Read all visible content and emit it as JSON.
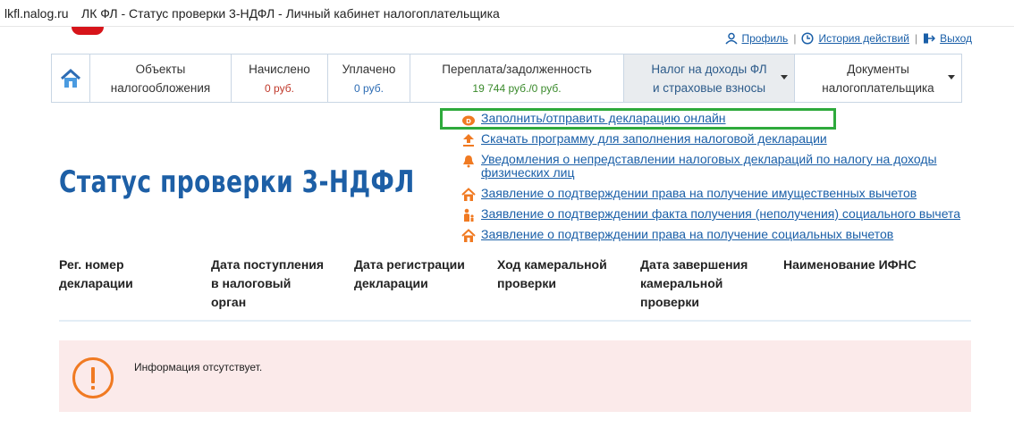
{
  "browser": {
    "domain": "lkfl.nalog.ru",
    "title": "ЛК ФЛ - Статус проверки 3-НДФЛ - Личный кабинет налогоплательщика"
  },
  "header": {
    "profile": "Профиль",
    "history": "История действий",
    "logout": "Выход"
  },
  "nav": {
    "objects": {
      "line1": "Объекты",
      "line2": "налогообложения"
    },
    "charged": {
      "label": "Начислено",
      "value": "0 руб."
    },
    "paid": {
      "label": "Уплачено",
      "value": "0 руб."
    },
    "balance": {
      "label": "Переплата/задолженность",
      "value": "19 744 руб./0 руб."
    },
    "tax": {
      "line1": "Налог на доходы ФЛ",
      "line2": "и страховые взносы"
    },
    "docs": {
      "line1": "Документы",
      "line2": "налогоплательщика"
    }
  },
  "menu": {
    "items": [
      {
        "label": "Заполнить/отправить декларацию онлайн",
        "icon": "declaration-icon"
      },
      {
        "label": "Скачать программу для заполнения налоговой декларации",
        "icon": "download-icon"
      },
      {
        "label_l1": "Уведомления о непредставлении налоговых деклараций по налогу на доходы",
        "label_l2": "физических лиц",
        "icon": "bell-icon"
      },
      {
        "label": "Заявление о подтверждении права на получение имущественных вычетов",
        "icon": "house-icon"
      },
      {
        "label": "Заявление о подтверждении факта получения (неполучения) социального вычета",
        "icon": "person-icon"
      },
      {
        "label": "Заявление о подтверждении права на получение социальных вычетов",
        "icon": "house-icon"
      }
    ]
  },
  "page": {
    "title": "Статус проверки 3-НДФЛ"
  },
  "table": {
    "headers": [
      [
        "Рег. номер",
        "декларации"
      ],
      [
        "Дата поступления",
        "в налоговый",
        "орган"
      ],
      [
        "Дата регистрации",
        "декларации"
      ],
      [
        "Ход камеральной",
        "проверки"
      ],
      [
        "Дата завершения",
        "камеральной",
        "проверки"
      ],
      [
        "Наименование ИФНС"
      ]
    ]
  },
  "alert": {
    "message": "Информация отсутствует."
  },
  "colors": {
    "accent": "#1d5fa6",
    "link": "#1a5fa8",
    "highlight": "#2eaa3c",
    "warning": "#f07a22"
  }
}
